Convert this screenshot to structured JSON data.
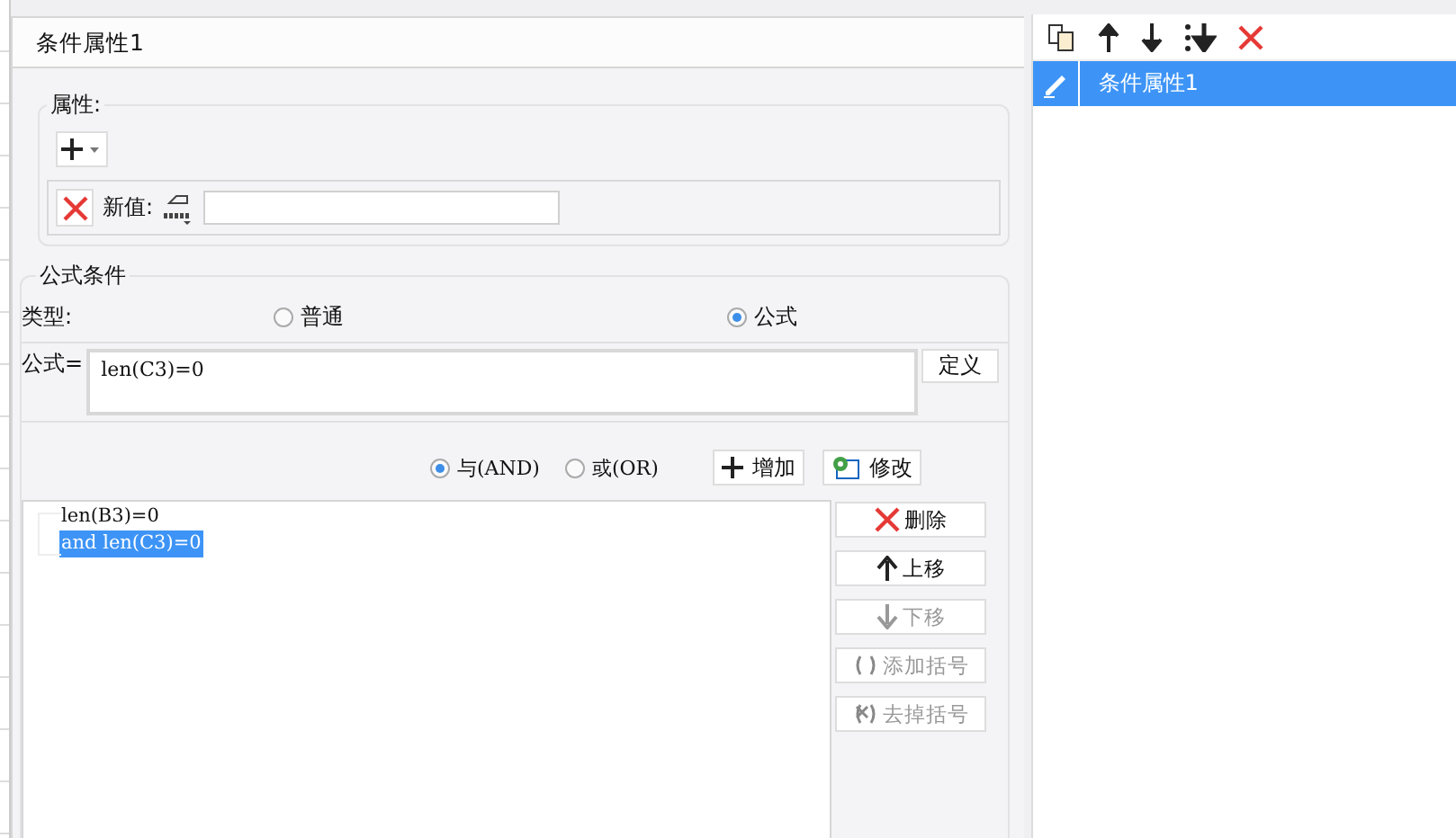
{
  "title": "条件属性1",
  "attributes": {
    "legend": "属性:",
    "new_value_label": "新值:"
  },
  "formula_condition": {
    "legend": "公式条件",
    "type_label": "类型:",
    "type_options": [
      {
        "label": "普通",
        "selected": false
      },
      {
        "label": "公式",
        "selected": true
      }
    ],
    "formula_label": "公式=",
    "formula": "len(C3)=0",
    "define_button": "定义",
    "logic_options": [
      {
        "label": "与(AND)",
        "selected": true
      },
      {
        "label": "或(OR)",
        "selected": false
      }
    ],
    "add_button": "增加",
    "modify_button": "修改",
    "conditions": [
      {
        "text": "len(B3)=0",
        "selected": false
      },
      {
        "text": "and len(C3)=0",
        "selected": true
      }
    ],
    "actions": [
      {
        "kind": "delete",
        "label": "删除",
        "disabled": false
      },
      {
        "kind": "up",
        "label": "上移",
        "disabled": false
      },
      {
        "kind": "down",
        "label": "下移",
        "disabled": true
      },
      {
        "kind": "add-bracket",
        "label": "添加括号",
        "disabled": true
      },
      {
        "kind": "remove-bracket",
        "label": "去掉括号",
        "disabled": true
      }
    ]
  },
  "sidebar": {
    "items": [
      {
        "label": "条件属性1",
        "selected": true
      }
    ]
  }
}
